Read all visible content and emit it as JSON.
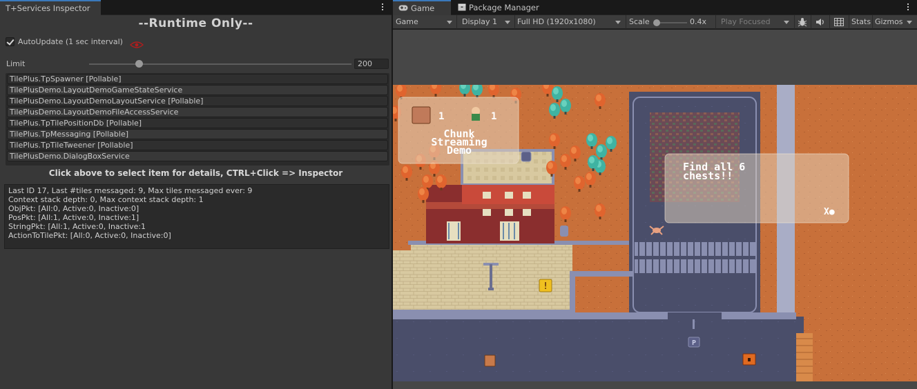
{
  "left_panel": {
    "tab_title": "T+Services Inspector",
    "runtime_title": "--Runtime Only--",
    "autoupdate": {
      "label": "AutoUpdate (1 sec interval)",
      "checked": true
    },
    "limit": {
      "label": "Limit",
      "value": "200",
      "slider_fraction": 0.19
    },
    "services": [
      "TilePlus.TpSpawner [Pollable]",
      "TilePlusDemo.LayoutDemoGameStateService",
      "TilePlusDemo.LayoutDemoLayoutService [Pollable]",
      "TilePlusDemo.LayoutDemoFileAccessService",
      "TilePlus.TpTilePositionDb [Pollable]",
      "TilePlus.TpMessaging [Pollable]",
      "TilePlus.TpTileTweener [Pollable]",
      "TilePlusDemo.DialogBoxService"
    ],
    "hint": "Click above to select item for details, CTRL+Click => Inspector",
    "details": [
      "Last ID 17, Last #tiles messaged: 9, Max tiles messaged ever: 9",
      "Context stack depth: 0, Max context stack depth: 1",
      "ObjPkt: [All:0, Active:0, Inactive:0]",
      "PosPkt: [All:1, Active:0, Inactive:1]",
      "StringPkt: [All:1, Active:0, Inactive:1",
      "ActionToTilePkt: [All:0, Active:0, Inactive:0]"
    ]
  },
  "right_panel": {
    "tabs": [
      {
        "label": "Game",
        "icon": "gamepad-icon"
      },
      {
        "label": "Package Manager",
        "icon": "package-icon"
      }
    ],
    "toolbar": {
      "mode": "Game",
      "display": "Display 1",
      "resolution": "Full HD (1920x1080)",
      "scale_label": "Scale",
      "scale_value": "0.4x",
      "play_mode": "Play Focused",
      "stats": "Stats",
      "gizmos": "Gizmos"
    },
    "game": {
      "counter_chest": "1",
      "counter_player": "1",
      "title_lines": [
        "Chunk",
        "Streaming",
        "Demo"
      ],
      "message_lines": [
        "Find all 6",
        "chests!!"
      ],
      "close_marker": "X●",
      "alert_glyph": "!",
      "parking_glyph": "P"
    }
  },
  "colors": {
    "accent": "#3a79bb",
    "panel_bg": "#383838",
    "dirt": "#c8703a",
    "road": "#4a4e6a",
    "plaza": "#d8c9a0"
  }
}
